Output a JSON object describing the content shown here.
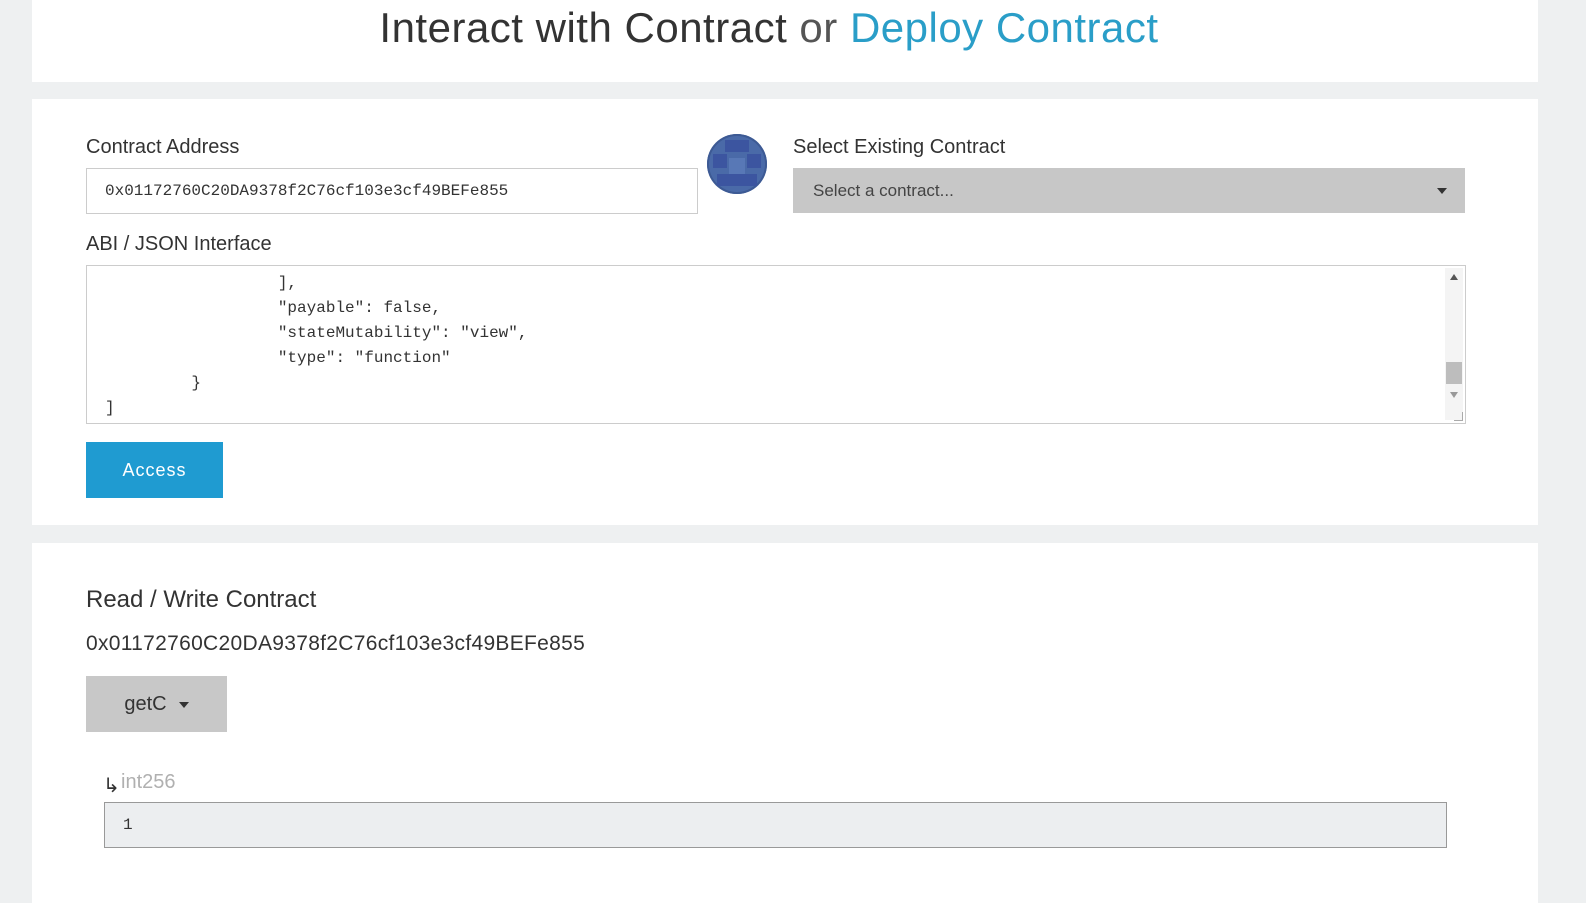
{
  "header": {
    "title_main": "Interact with Contract",
    "title_or": "or",
    "title_link": "Deploy Contract"
  },
  "form": {
    "address_label": "Contract Address",
    "address_value": "0x01172760C20DA9378f2C76cf103e3cf49BEFe855",
    "select_label": "Select Existing Contract",
    "select_value": "Select a contract...",
    "abi_label": "ABI / JSON Interface",
    "abi_lines": [
      "                  ],",
      "                  \"payable\": false,",
      "                  \"stateMutability\": \"view\",",
      "                  \"type\": \"function\"",
      "         }",
      "]"
    ],
    "access_label": "Access"
  },
  "read_write": {
    "title": "Read / Write Contract",
    "address": "0x01172760C20DA9378f2C76cf103e3cf49BEFe855",
    "function_selected": "getC",
    "output_arrow": "↳",
    "output_type": "int256",
    "output_value": "1"
  },
  "colors": {
    "accent": "#1f9bd1",
    "link": "#2a9ec8",
    "dropdown_bg": "#c7c7c7",
    "identicon": "#4a6aa8"
  },
  "icons": {
    "identicon": "identicon-avatar",
    "caret": "chevron-down-icon"
  }
}
